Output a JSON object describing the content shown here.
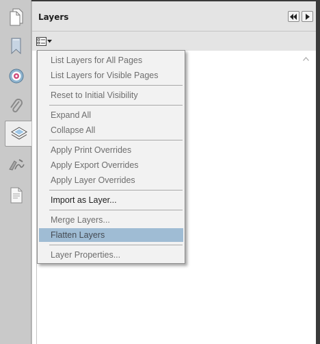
{
  "panel": {
    "title": "Layers"
  },
  "rail_items": [
    {
      "icon": "pages-icon"
    },
    {
      "icon": "bookmark-icon"
    },
    {
      "icon": "target-icon"
    },
    {
      "icon": "paperclip-icon"
    },
    {
      "icon": "layers-icon"
    },
    {
      "icon": "signature-icon"
    },
    {
      "icon": "document-icon"
    }
  ],
  "menu": {
    "items": [
      {
        "label": "List Layers for All Pages",
        "disabled": true
      },
      {
        "label": "List Layers for Visible Pages",
        "disabled": true
      },
      {
        "label": "Reset to Initial Visibility",
        "disabled": true
      },
      {
        "label": "Expand All",
        "disabled": true
      },
      {
        "label": "Collapse All",
        "disabled": true
      },
      {
        "label": "Apply Print Overrides",
        "disabled": true
      },
      {
        "label": "Apply Export Overrides",
        "disabled": true
      },
      {
        "label": "Apply Layer Overrides",
        "disabled": true
      },
      {
        "label": "Import as Layer...",
        "disabled": false
      },
      {
        "label": "Merge Layers...",
        "disabled": true
      },
      {
        "label": "Flatten Layers",
        "disabled": true,
        "highlighted": true
      },
      {
        "label": "Layer Properties...",
        "disabled": true
      }
    ]
  },
  "colors": {
    "highlight": "#9fbcd4",
    "rail": "#c9c9c9",
    "disabled_text": "#6d6d6d"
  }
}
